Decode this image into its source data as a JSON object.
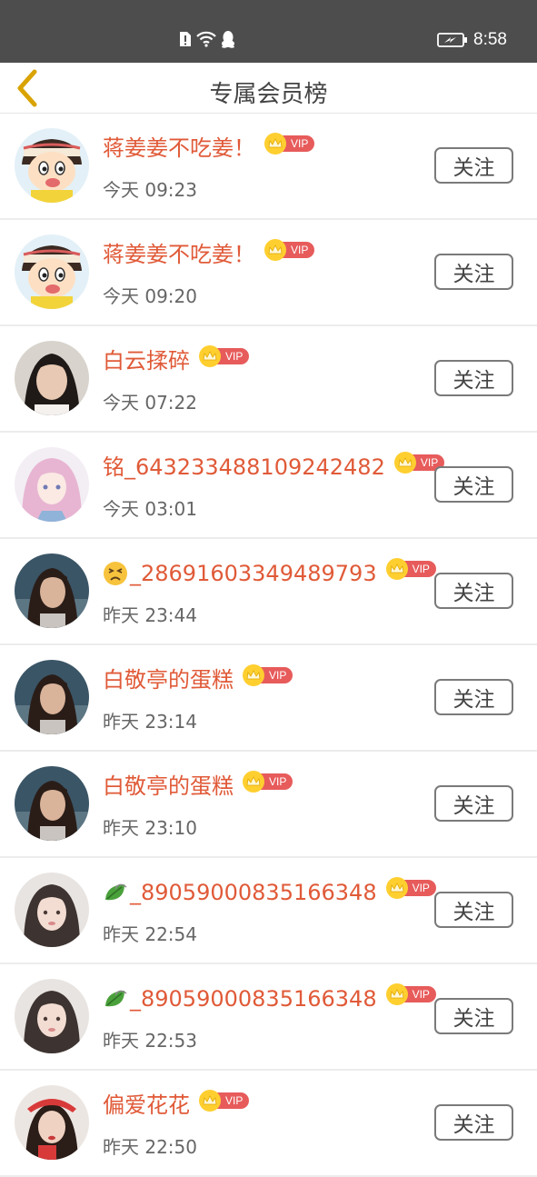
{
  "status_bar": {
    "time": "8:58",
    "icons": [
      "sim-alert-icon",
      "wifi-icon",
      "qq-icon",
      "battery-charging-icon"
    ]
  },
  "header": {
    "title": "专属会员榜",
    "back_icon": "chevron-left-icon"
  },
  "colors": {
    "status_bar_bg": "#4d4d4d",
    "name_color": "#e05a38",
    "vip_pill": "#e75b5b",
    "vip_crown": "#ffcf30",
    "back_arrow": "#d9a300"
  },
  "vip_label": "VIP",
  "follow_label": "关注",
  "members": [
    {
      "name": "蒋姜姜不吃姜！",
      "time": "今天 09:23",
      "avatar": "cartoon-boy-avatar"
    },
    {
      "name": "蒋姜姜不吃姜！",
      "time": "今天 09:20",
      "avatar": "cartoon-boy-avatar"
    },
    {
      "name": "白云揉碎",
      "time": "今天 07:22",
      "avatar": "girl-photo-avatar"
    },
    {
      "name": "铭_643233488109242482",
      "time": "今天 03:01",
      "avatar": "anime-girl-avatar"
    },
    {
      "name": "_28691603349489793",
      "time": "昨天 23:44",
      "avatar": "woman-photo-avatar",
      "emoji": "tired-face-emoji"
    },
    {
      "name": "白敬亭的蛋糕",
      "time": "昨天 23:14",
      "avatar": "woman-photo-avatar"
    },
    {
      "name": "白敬亭的蛋糕",
      "time": "昨天 23:10",
      "avatar": "woman-photo-avatar"
    },
    {
      "name": "_89059000835166348",
      "time": "昨天 22:54",
      "avatar": "painted-girl-avatar",
      "emoji": "leaf-emoji"
    },
    {
      "name": "_89059000835166348",
      "time": "昨天 22:53",
      "avatar": "painted-girl-avatar",
      "emoji": "leaf-emoji"
    },
    {
      "name": "偏爱花花",
      "time": "昨天 22:50",
      "avatar": "girl-red-hat-avatar"
    }
  ]
}
